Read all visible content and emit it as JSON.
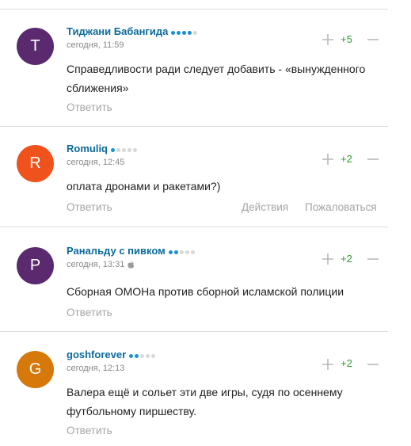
{
  "comments": [
    {
      "avatar_letter": "Т",
      "avatar_color": "#5b2a6e",
      "author": "Тиджани Бабангида",
      "rating_dots": 4,
      "date": "сегодня, 11:59",
      "apple_icon": false,
      "text": "Справедливости ради следует добавить - «вынужденного сближения»",
      "score": "+5",
      "reply_label": "Ответить"
    },
    {
      "avatar_letter": "R",
      "avatar_color": "#f0521e",
      "author": "Romuliq",
      "rating_dots": 1,
      "date": "сегодня, 12:45",
      "apple_icon": false,
      "text": "оплата дронами и ракетами?)",
      "score": "+2",
      "reply_label": "Ответить",
      "actions_label": "Действия",
      "report_label": "Пожаловаться"
    },
    {
      "avatar_letter": "Р",
      "avatar_color": "#5b2a6e",
      "author": "Ранальду с пивком",
      "rating_dots": 2,
      "date": "сегодня, 13:31",
      "apple_icon": true,
      "text": "Сборная ОМОНа против сборной исламской полиции",
      "score": "+2",
      "reply_label": "Ответить"
    },
    {
      "avatar_letter": "G",
      "avatar_color": "#d6780a",
      "author": "goshforever",
      "rating_dots": 2,
      "date": "сегодня, 12:13",
      "apple_icon": false,
      "text": "Валера ещё и сольет эти две игры, судя по осеннему футбольному пиршеству.",
      "score": "+2",
      "reply_label": "Ответить"
    }
  ],
  "colors": {
    "dot_active": "#1a8fd6",
    "dot_inactive": "#d8d8d8",
    "score": "#2e9b2e",
    "link": "#0b6a9c",
    "muted": "#a5a5a5"
  }
}
